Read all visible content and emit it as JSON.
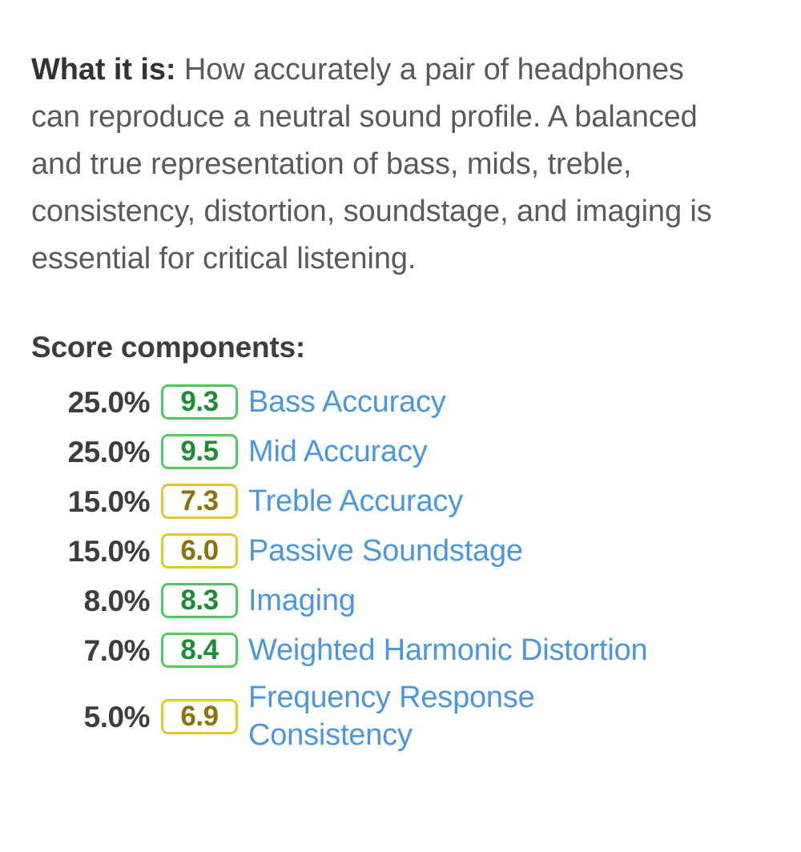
{
  "definition": {
    "lead_label": "What it is:",
    "text": " How accurately a pair of headphones can reproduce a neutral sound profile. A balanced and true representation of bass, mids, treble, consistency, distortion, soundstage, and imaging is essential for critical listening."
  },
  "components": {
    "heading": "Score components:",
    "colors": {
      "link_blue": "#4a96e0",
      "good_border": "#4ecb5c",
      "good_text": "#1f8b35",
      "mid_border": "#e9c52e",
      "mid_text": "#8a7408",
      "body_gray": "#5a5a5a",
      "heading_gray": "#3d3d3d"
    },
    "rows": [
      {
        "weight": "25.0%",
        "score": "9.3",
        "tier": "good",
        "label": "Bass Accuracy"
      },
      {
        "weight": "25.0%",
        "score": "9.5",
        "tier": "good",
        "label": "Mid Accuracy"
      },
      {
        "weight": "15.0%",
        "score": "7.3",
        "tier": "mid",
        "label": "Treble Accuracy"
      },
      {
        "weight": "15.0%",
        "score": "6.0",
        "tier": "mid",
        "label": "Passive Soundstage"
      },
      {
        "weight": "8.0%",
        "score": "8.3",
        "tier": "good",
        "label": "Imaging"
      },
      {
        "weight": "7.0%",
        "score": "8.4",
        "tier": "good",
        "label": "Weighted Harmonic Distortion"
      },
      {
        "weight": "5.0%",
        "score": "6.9",
        "tier": "mid",
        "label": "Frequency Response Consistency"
      }
    ]
  }
}
